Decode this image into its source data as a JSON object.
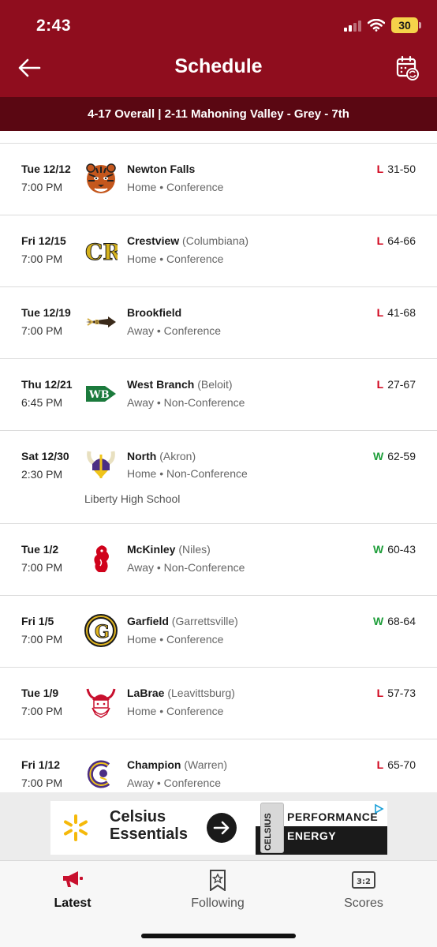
{
  "status_bar": {
    "time": "2:43",
    "battery": "30"
  },
  "nav": {
    "title": "Schedule"
  },
  "record": "4-17 Overall | 2-11 Mahoning Valley - Grey - 7th",
  "games": [
    {
      "date": "Tue 12/12",
      "time": "7:00 PM",
      "opponent": "Newton Falls",
      "location": "",
      "site": "Home",
      "type": "Conference",
      "wl": "L",
      "score": "31-50",
      "venue": "",
      "logo": "tiger-icon",
      "colors": {
        "primary": "#c4571d",
        "secondary": "#222222"
      }
    },
    {
      "date": "Fri 12/15",
      "time": "7:00 PM",
      "opponent": "Crestview",
      "location": "(Columbiana)",
      "site": "Home",
      "type": "Conference",
      "wl": "L",
      "score": "64-66",
      "venue": "",
      "logo": "cr-monogram-icon",
      "logo_text": "CR",
      "colors": {
        "primary": "#d6b31e",
        "secondary": "#1a1a1a"
      }
    },
    {
      "date": "Tue 12/19",
      "time": "7:00 PM",
      "opponent": "Brookfield",
      "location": "",
      "site": "Away",
      "type": "Conference",
      "wl": "L",
      "score": "41-68",
      "venue": "",
      "logo": "arrow-logo-icon",
      "colors": {
        "primary": "#3a2a1a",
        "secondary": "#d4b04a"
      }
    },
    {
      "date": "Thu 12/21",
      "time": "6:45 PM",
      "opponent": "West Branch",
      "location": "(Beloit)",
      "site": "Away",
      "type": "Non-Conference",
      "wl": "L",
      "score": "27-67",
      "venue": "",
      "logo": "wb-arrow-icon",
      "logo_text": "WB",
      "colors": {
        "primary": "#1b7a3c",
        "secondary": "#ffffff"
      }
    },
    {
      "date": "Sat 12/30",
      "time": "2:30 PM",
      "opponent": "North",
      "location": "(Akron)",
      "site": "Home",
      "type": "Non-Conference",
      "wl": "W",
      "score": "62-59",
      "venue": "Liberty High School",
      "logo": "viking-helmet-icon",
      "colors": {
        "primary": "#4b2e83",
        "secondary": "#f0c419"
      }
    },
    {
      "date": "Tue 1/2",
      "time": "7:00 PM",
      "opponent": "McKinley",
      "location": "(Niles)",
      "site": "Away",
      "type": "Non-Conference",
      "wl": "W",
      "score": "60-43",
      "venue": "",
      "logo": "red-dragon-icon",
      "colors": {
        "primary": "#d0021b",
        "secondary": "#ffffff"
      }
    },
    {
      "date": "Fri 1/5",
      "time": "7:00 PM",
      "opponent": "Garfield",
      "location": "(Garrettsville)",
      "site": "Home",
      "type": "Conference",
      "wl": "W",
      "score": "68-64",
      "venue": "",
      "logo": "g-monogram-icon",
      "logo_text": "G",
      "colors": {
        "primary": "#1a1a1a",
        "secondary": "#e0b521"
      }
    },
    {
      "date": "Tue 1/9",
      "time": "7:00 PM",
      "opponent": "LaBrae",
      "location": "(Leavittsburg)",
      "site": "Home",
      "type": "Conference",
      "wl": "L",
      "score": "57-73",
      "venue": "",
      "logo": "viking-head-icon",
      "colors": {
        "primary": "#c8102e",
        "secondary": "#ffffff"
      }
    },
    {
      "date": "Fri 1/12",
      "time": "7:00 PM",
      "opponent": "Champion",
      "location": "(Warren)",
      "site": "Away",
      "type": "Conference",
      "wl": "L",
      "score": "65-70",
      "venue": "",
      "logo": "c-mascot-icon",
      "colors": {
        "primary": "#4b2e83",
        "secondary": "#f0c419"
      }
    }
  ],
  "ad": {
    "line1": "Celsius",
    "line2": "Essentials",
    "can_text": "CELSIUS",
    "word1": "PERFORMANCE",
    "word2": "ENERGY"
  },
  "tabs": [
    {
      "label": "Latest",
      "icon": "megaphone-icon",
      "active": true
    },
    {
      "label": "Following",
      "icon": "bookmark-star-icon",
      "active": false
    },
    {
      "label": "Scores",
      "icon": "scoreboard-icon",
      "active": false,
      "icon_text": "3:2"
    }
  ],
  "colors": {
    "brand": "#8f0d1e",
    "brand_dark": "#5a0712",
    "loss": "#d0021b",
    "win": "#1e9e3a"
  }
}
